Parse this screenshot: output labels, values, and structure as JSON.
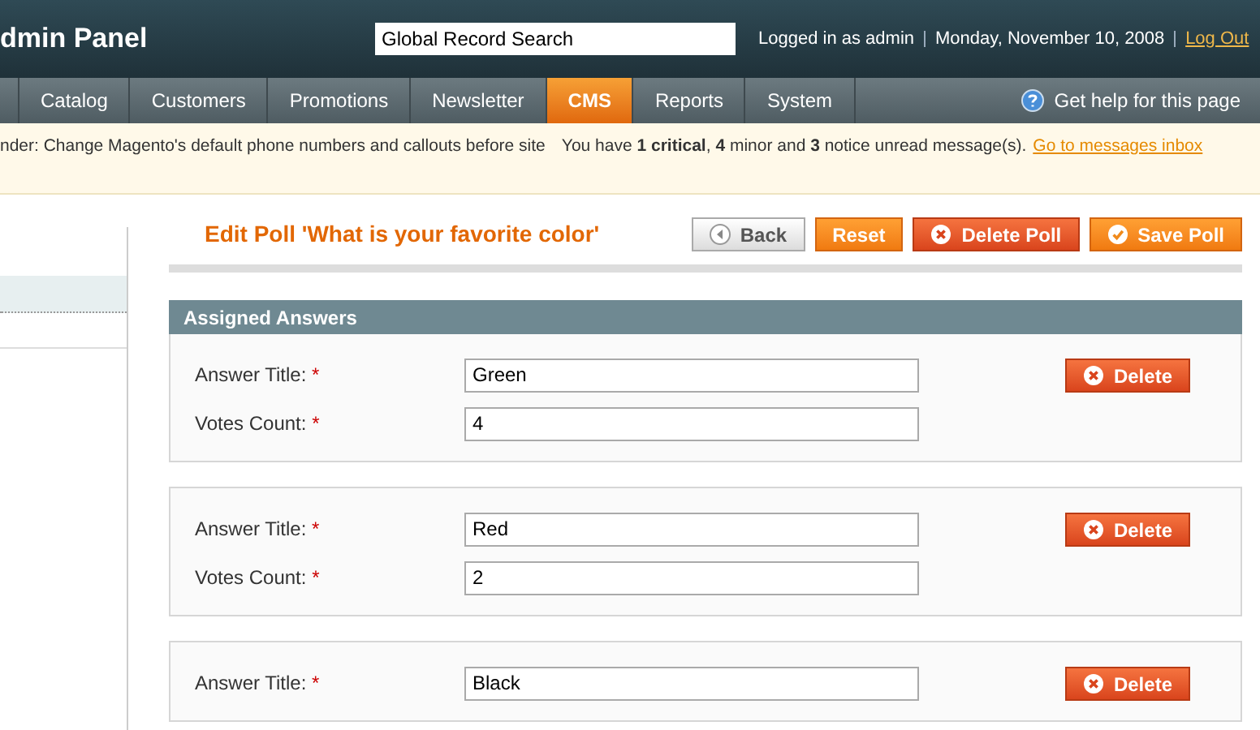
{
  "header": {
    "title": "dmin Panel",
    "search": {
      "value": "Global Record Search"
    },
    "user_text": "Logged in as admin",
    "date": "Monday, November 10, 2008",
    "logout": "Log Out"
  },
  "nav": {
    "items": [
      {
        "label": "Catalog",
        "selected": false
      },
      {
        "label": "Customers",
        "selected": false
      },
      {
        "label": "Promotions",
        "selected": false
      },
      {
        "label": "Newsletter",
        "selected": false
      },
      {
        "label": "CMS",
        "selected": true
      },
      {
        "label": "Reports",
        "selected": false
      },
      {
        "label": "System",
        "selected": false
      }
    ],
    "help": "Get help for this page"
  },
  "notice": {
    "reminder": "nder: Change Magento's default phone numbers and callouts before site",
    "messages": "You have **1 critical**, **4** minor and **3** notice unread message(s).",
    "link": "Go to messages inbox"
  },
  "page": {
    "title": "Edit Poll 'What is your favorite color'",
    "buttons": [
      {
        "label": "Back",
        "kind": "back"
      },
      {
        "label": "Reset",
        "kind": "plain"
      },
      {
        "label": "Delete Poll",
        "kind": "delete"
      },
      {
        "label": "Save Poll",
        "kind": "save"
      }
    ]
  },
  "section": {
    "title": "Assigned Answers"
  },
  "answers": [
    {
      "fields": [
        {
          "label": "Answer Title:",
          "mark": "*",
          "value": "Green"
        },
        {
          "label": "Votes Count:",
          "mark": "*",
          "value": "4"
        }
      ],
      "delete": "Delete"
    },
    {
      "fields": [
        {
          "label": "Answer Title:",
          "mark": "*",
          "value": "Red"
        },
        {
          "label": "Votes Count:",
          "mark": "*",
          "value": "2"
        }
      ],
      "delete": "Delete"
    },
    {
      "fields": [
        {
          "label": "Answer Title:",
          "mark": "*",
          "value": "Black"
        }
      ],
      "delete": "Delete"
    }
  ]
}
